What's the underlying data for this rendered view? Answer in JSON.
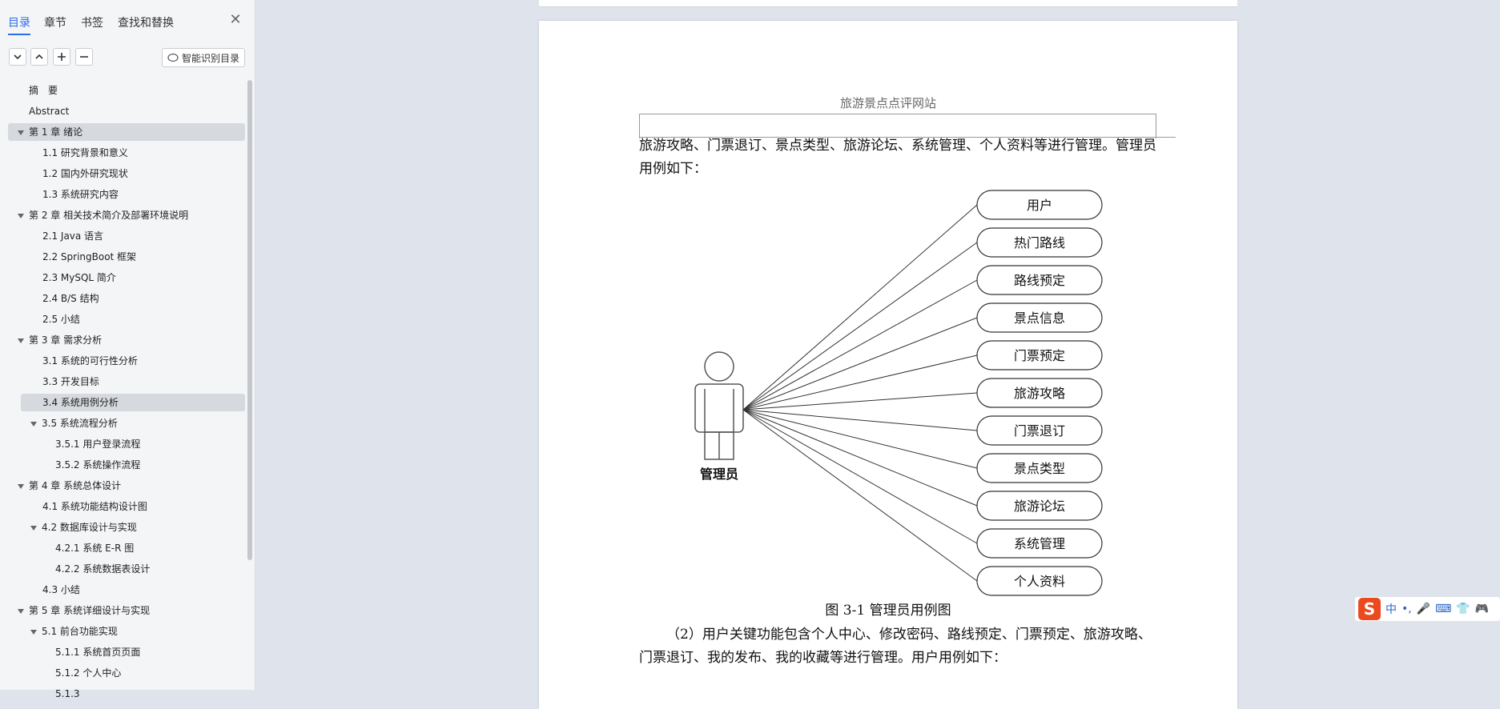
{
  "sidebar": {
    "tabs": [
      "目录",
      "章节",
      "书签",
      "查找和替换"
    ],
    "smart_toc_label": "智能识别目录",
    "toc": [
      "摘　要",
      "Abstract",
      "第 1 章 绪论",
      "1.1 研究背景和意义",
      "1.2 国内外研究现状",
      "1.3 系统研究内容",
      "第 2 章 相关技术简介及部署环境说明",
      "2.1 Java 语言",
      "2.2 SpringBoot 框架",
      "2.3 MySQL 简介",
      "2.4 B/S 结构",
      "2.5 小结",
      "第 3 章 需求分析",
      "3.1 系统的可行性分析",
      "3.3 开发目标",
      "3.4 系统用例分析",
      "3.5 系统流程分析",
      "3.5.1 用户登录流程",
      "3.5.2 系统操作流程",
      "第 4 章 系统总体设计",
      "4.1 系统功能结构设计图",
      "4.2 数据库设计与实现",
      "4.2.1 系统 E-R 图",
      "4.2.2 系统数据表设计",
      "4.3 小结",
      "第 5 章 系统详细设计与实现",
      "5.1 前台功能实现",
      "5.1.1 系统首页页面",
      "5.1.2 个人中心",
      "5.1.3"
    ]
  },
  "document": {
    "header": "旅游景点点评网站",
    "para1": "旅游攻略、门票退订、景点类型、旅游论坛、系统管理、个人资料等进行管理。管理员用例如下：",
    "actor": "管理员",
    "use_cases": [
      "用户",
      "热门路线",
      "路线预定",
      "景点信息",
      "门票预定",
      "旅游攻略",
      "门票退订",
      "景点类型",
      "旅游论坛",
      "系统管理",
      "个人资料"
    ],
    "caption": "图 3-1  管理员用例图",
    "para2": "（2）用户关键功能包含个人中心、修改密码、路线预定、门票预定、旅游攻略、门票退订、我的发布、我的收藏等进行管理。用户用例如下："
  },
  "ime": {
    "logo": "S",
    "mode": "中"
  }
}
